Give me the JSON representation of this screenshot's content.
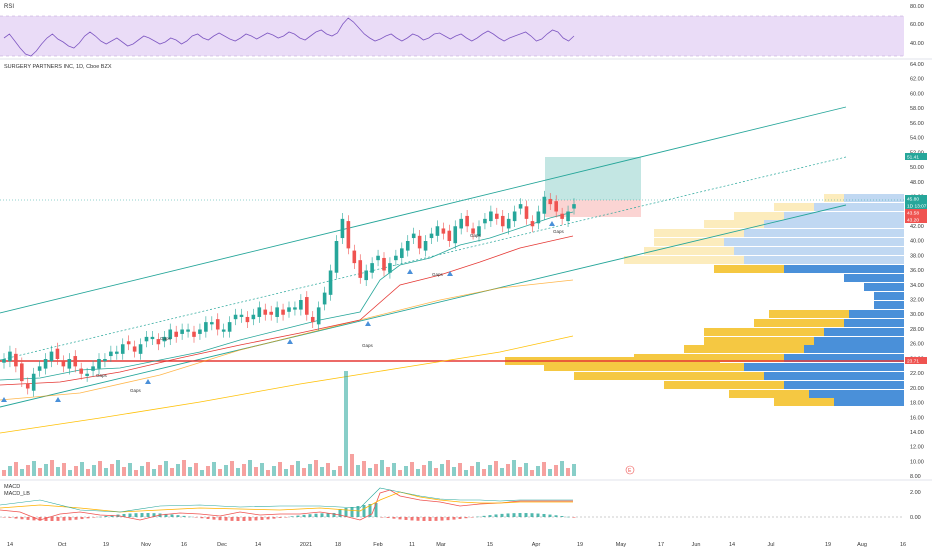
{
  "symbol_title": "SURGERY PARTNERS INC, 1D, Cboe BZX",
  "rsi_panel": {
    "label": "RSI",
    "ticks": [
      "80.00",
      "60.00",
      "40.00"
    ],
    "values": [
      58,
      62,
      55,
      48,
      42,
      40,
      45,
      52,
      58,
      62,
      57,
      54,
      50,
      48,
      53,
      60,
      64,
      60,
      55,
      52,
      55,
      58,
      54,
      50,
      52,
      56,
      60,
      58,
      55,
      52,
      54,
      58,
      56,
      52,
      55,
      60,
      62,
      58,
      56,
      60,
      63,
      60,
      57,
      55,
      58,
      62,
      60,
      57,
      60,
      63,
      61,
      58,
      60,
      64,
      62,
      58,
      56,
      60,
      64,
      66,
      62,
      60,
      63,
      72,
      78,
      74,
      68,
      62,
      58,
      55,
      57,
      60,
      62,
      58,
      55,
      58,
      62,
      60,
      56,
      58,
      62,
      63,
      60,
      57,
      60,
      62,
      58,
      55,
      58,
      62,
      65,
      62,
      58,
      55,
      58,
      60,
      62,
      64,
      60,
      55,
      57,
      62,
      66,
      64,
      58,
      55,
      60
    ]
  },
  "price_axis": {
    "ticks": [
      "64.00",
      "62.00",
      "60.00",
      "58.00",
      "56.00",
      "54.00",
      "52.00",
      "50.00",
      "48.00",
      "46.00",
      "44.00",
      "42.00",
      "40.00",
      "38.00",
      "36.00",
      "34.00",
      "32.00",
      "30.00",
      "28.00",
      "26.00",
      "24.00",
      "22.00",
      "20.00",
      "18.00",
      "16.00",
      "14.00",
      "12.00",
      "10.00",
      "8.00"
    ],
    "markers": [
      {
        "text": "51.41",
        "color": "#26a69a"
      },
      {
        "text": "45.80",
        "color": "#26a69a"
      },
      {
        "text": "1D 13:07",
        "color": "#26a69a"
      },
      {
        "text": "43.58",
        "color": "#ef5350"
      },
      {
        "text": "43.20",
        "color": "#ef5350"
      },
      {
        "text": "23.71",
        "color": "#ef5350"
      }
    ]
  },
  "annotations": {
    "earnings_labels": [
      "Gaps",
      "Gaps",
      "Gaps",
      "Gaps",
      "Gaps",
      "Gaps",
      "Gaps"
    ],
    "volume_badge": "E"
  },
  "macd_panel": {
    "label1": "MACD",
    "label2": "MACD_LB",
    "ticks": [
      "2.00",
      "0.00"
    ]
  },
  "time_axis": {
    "labels": [
      "14",
      "Oct",
      "19",
      "Nov",
      "16",
      "Dec",
      "14",
      "2021",
      "18",
      "Feb",
      "11",
      "Mar",
      "15",
      "Apr",
      "19",
      "May",
      "17",
      "Jun",
      "14",
      "Jul",
      "19",
      "Aug",
      "16"
    ]
  },
  "colors": {
    "up": "#26a69a",
    "down": "#ef5350",
    "rsi_band": "#e6d5f5",
    "profile_blue": "#4a90d9",
    "profile_yellow": "#f5c842",
    "channel": "#26a69a",
    "support": "#ef5350"
  }
}
